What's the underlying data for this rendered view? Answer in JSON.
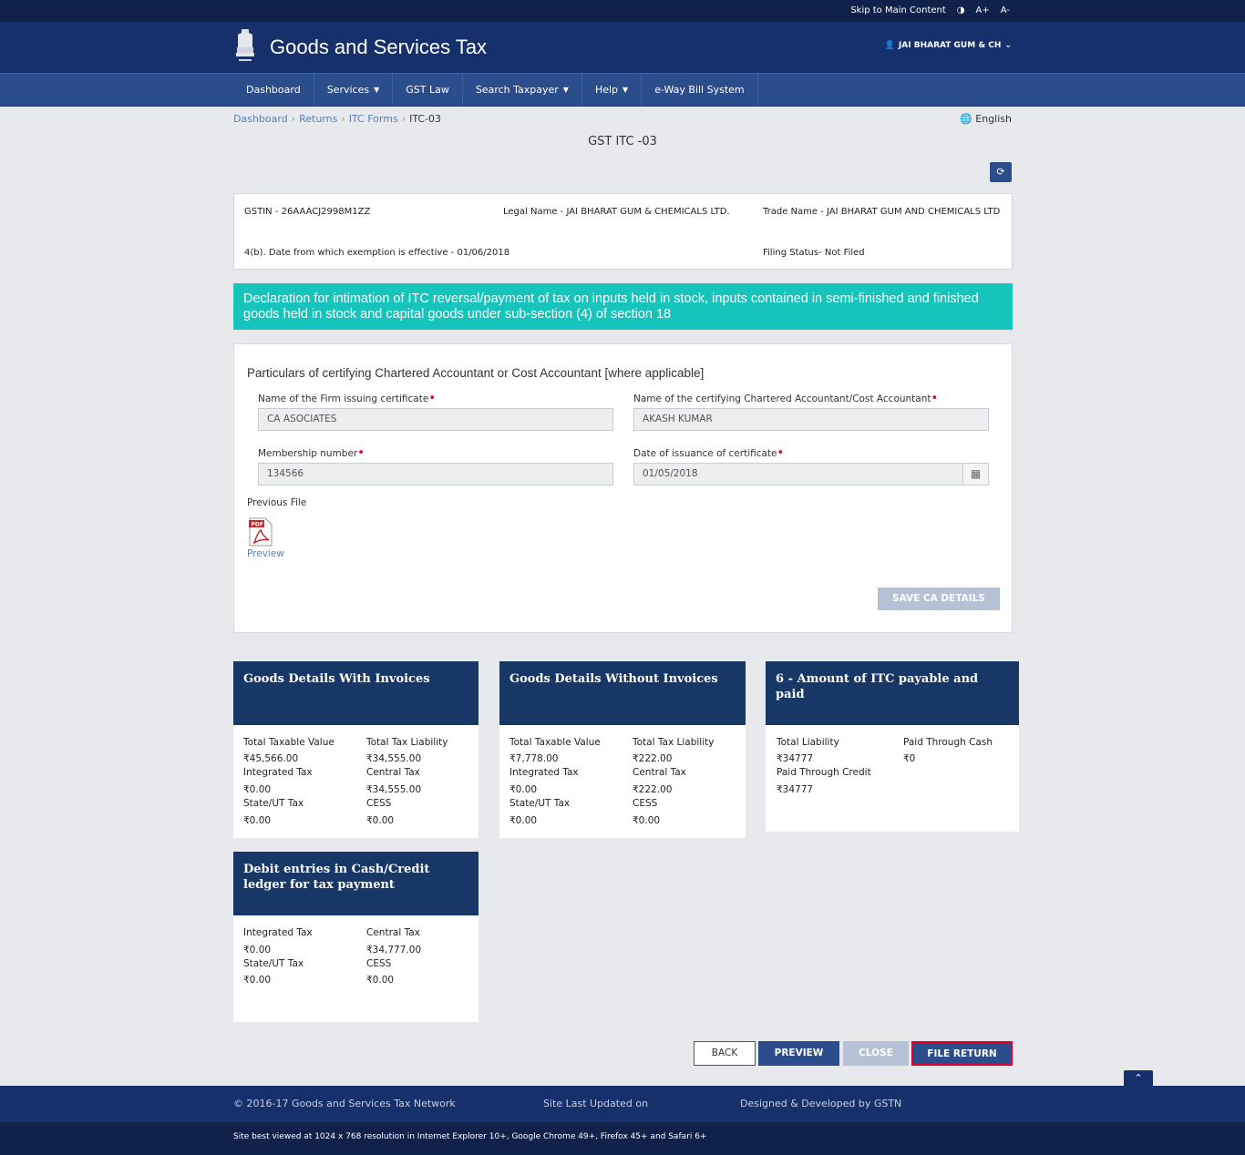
{
  "topstrip": {
    "skip": "Skip to Main Content",
    "contrast_icon": "contrast-icon",
    "font_up": "A+",
    "font_down": "A-"
  },
  "header": {
    "title": "Goods and Services Tax",
    "user": "JAI BHARAT GUM & CH"
  },
  "nav": [
    {
      "label": "Dashboard",
      "dropdown": false
    },
    {
      "label": "Services",
      "dropdown": true
    },
    {
      "label": "GST Law",
      "dropdown": false
    },
    {
      "label": "Search Taxpayer",
      "dropdown": true
    },
    {
      "label": "Help",
      "dropdown": true
    },
    {
      "label": "e-Way Bill System",
      "dropdown": false
    }
  ],
  "breadcrumb": {
    "dashboard": "Dashboard",
    "returns": "Returns",
    "itc_forms": "ITC Forms",
    "current": "ITC-03"
  },
  "language": "English",
  "page_title": "GST ITC -03",
  "info": {
    "gstin": "GSTIN - 26AAACJ2998M1ZZ",
    "legal_name": "Legal Name - JAI BHARAT GUM & CHEMICALS LTD.",
    "trade_name": "Trade Name - JAI BHARAT GUM AND CHEMICALS LTD",
    "exemption_date": "4(b). Date from which exemption is effective - 01/06/2018",
    "filing_status": "Filing Status- Not Filed"
  },
  "banner": "Declaration for intimation of ITC reversal/payment of tax on inputs held in stock, inputs contained in semi-finished and finished goods held in stock and capital goods under sub-section (4) of section 18",
  "ca": {
    "heading": "Particulars of certifying Chartered Accountant or Cost Accountant [where applicable]",
    "firm_label": "Name of the Firm issuing certificate",
    "firm_value": "CA ASOCIATES",
    "accountant_label": "Name of the certifying Chartered Accountant/Cost Accountant",
    "accountant_value": "AKASH KUMAR",
    "membership_label": "Membership number",
    "membership_value": "134566",
    "date_label": "Date of issuance of certificate",
    "date_value": "01/05/2018",
    "previous_file": "Previous File",
    "preview_link": "Preview",
    "save_button": "SAVE CA DETAILS",
    "pdf_badge": "PDF"
  },
  "cards": {
    "with_invoices": {
      "title": "Goods Details With Invoices",
      "l1": "Total Taxable Value",
      "v1": "₹45,566.00",
      "l2": "Total Tax Liability",
      "v2": "₹34,555.00",
      "l3": "Integrated Tax",
      "v3": "₹0.00",
      "l4": "Central Tax",
      "v4": "₹34,555.00",
      "l5": "State/UT Tax",
      "v5": "₹0.00",
      "l6": "CESS",
      "v6": "₹0.00"
    },
    "without_invoices": {
      "title": "Goods Details Without Invoices",
      "l1": "Total Taxable Value",
      "v1": "₹7,778.00",
      "l2": "Total Tax Liability",
      "v2": "₹222.00",
      "l3": "Integrated Tax",
      "v3": "₹0.00",
      "l4": "Central Tax",
      "v4": "₹222.00",
      "l5": "State/UT Tax",
      "v5": "₹0.00",
      "l6": "CESS",
      "v6": "₹0.00"
    },
    "itc_payable": {
      "title": "6 - Amount of ITC payable and paid",
      "l1": "Total Liability",
      "v1": "₹34777",
      "l2": "Paid Through Cash",
      "v2": "₹0",
      "l3": "Paid Through Credit",
      "v3": "₹34777"
    },
    "debit_entries": {
      "title": "Debit entries in Cash/Credit ledger for tax payment",
      "l1": "Integrated Tax",
      "v1": "₹0.00",
      "l2": "Central Tax",
      "v2": "₹34,777.00",
      "l3": "State/UT Tax",
      "v3": "₹0.00",
      "l4": "CESS",
      "v4": "₹0.00"
    }
  },
  "actions": {
    "back": "BACK",
    "preview": "PREVIEW",
    "close": "CLOSE",
    "file_return": "FILE RETURN"
  },
  "footer": {
    "copyright": "© 2016-17 Goods and Services Tax Network",
    "updated": "Site Last Updated on",
    "designed": "Designed & Developed by GSTN",
    "best_viewed": "Site best viewed at 1024 x 768 resolution in Internet Explorer 10+, Google Chrome 49+, Firefox 45+ and Safari 6+"
  },
  "colors": {
    "header": "#15306b",
    "nav": "#2b4d8c",
    "banner": "#17c4bb",
    "card_head": "#173866",
    "required": "#e4002b"
  }
}
